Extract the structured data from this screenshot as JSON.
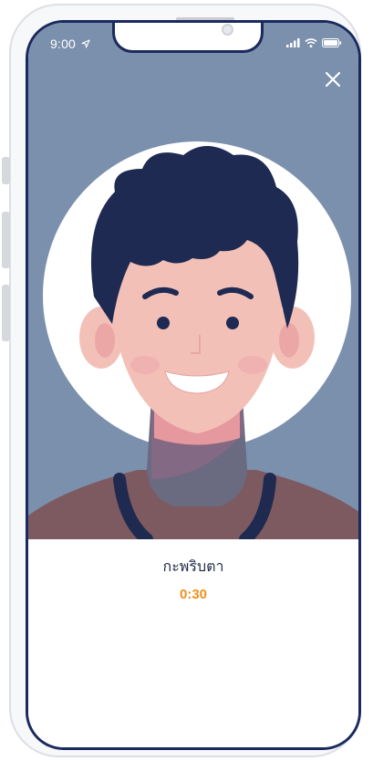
{
  "status_bar": {
    "time": "9:00",
    "icons": [
      "location-arrow-icon",
      "signal-icon",
      "wifi-icon",
      "battery-icon"
    ]
  },
  "camera_view": {
    "close_icon": "close-icon",
    "background_color": "#7b90ad",
    "illustration": "smiling-man-face"
  },
  "liveness_check": {
    "instruction": "กะพริบตา",
    "timer": "0:30"
  },
  "colors": {
    "accent": "#f0901e",
    "frame": "#1a2a5e",
    "text": "#1f2a44"
  }
}
